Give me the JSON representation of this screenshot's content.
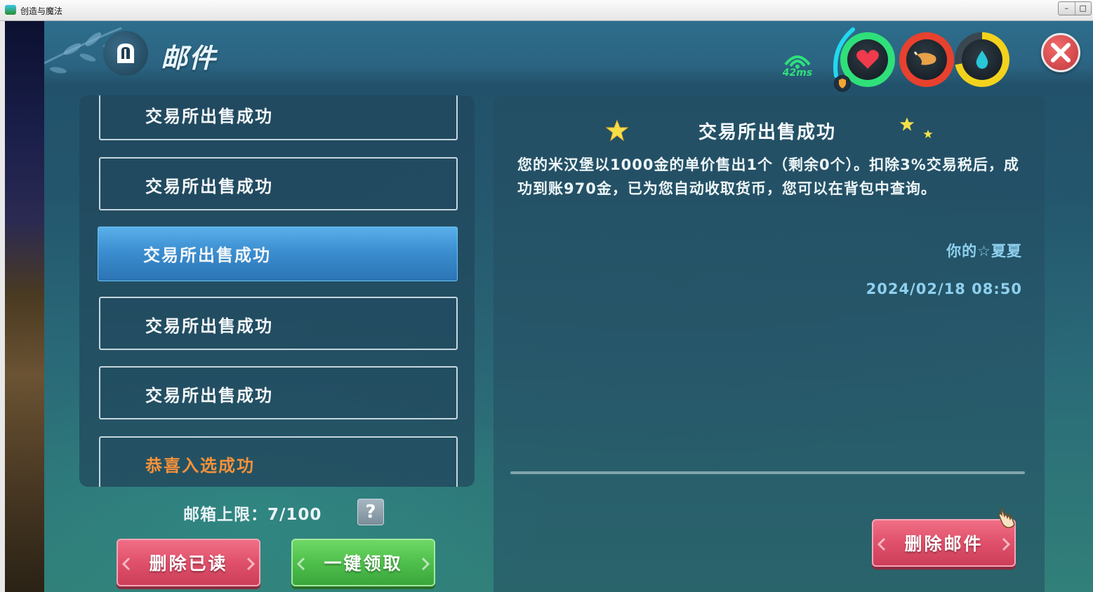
{
  "window": {
    "title": "创造与魔法",
    "minimize_glyph": "–",
    "restore_glyph": "□"
  },
  "header": {
    "title": "邮件",
    "ping": "42ms",
    "gauges": [
      {
        "name": "health",
        "icon": "heart-icon",
        "color": "#2fe07a"
      },
      {
        "name": "hunger",
        "icon": "drumstick-icon",
        "color": "#e8412e"
      },
      {
        "name": "thirst",
        "icon": "water-drop-icon",
        "color": "#f2d21c"
      }
    ],
    "close_glyph": "✕"
  },
  "mail_list": {
    "items": [
      {
        "label": "交易所出售成功",
        "selected": false
      },
      {
        "label": "交易所出售成功",
        "selected": false
      },
      {
        "label": "交易所出售成功",
        "selected": true
      },
      {
        "label": "交易所出售成功",
        "selected": false
      },
      {
        "label": "交易所出售成功",
        "selected": false
      },
      {
        "label": "恭喜入选成功",
        "selected": false
      }
    ],
    "quota_label": "邮箱上限：",
    "quota_value": "7/100",
    "help_glyph": "?",
    "delete_read_label": "删除已读",
    "claim_all_label": "一键领取"
  },
  "detail": {
    "title": "交易所出售成功",
    "body": "您的米汉堡以1000金的单价售出1个（剩余0个）。扣除3%交易税后，成功到账970金，已为您自动收取货币，您可以在背包中查询。",
    "sender": "你的☆夏夏",
    "datetime": "2024/02/18 08:50",
    "delete_label": "删除邮件"
  }
}
